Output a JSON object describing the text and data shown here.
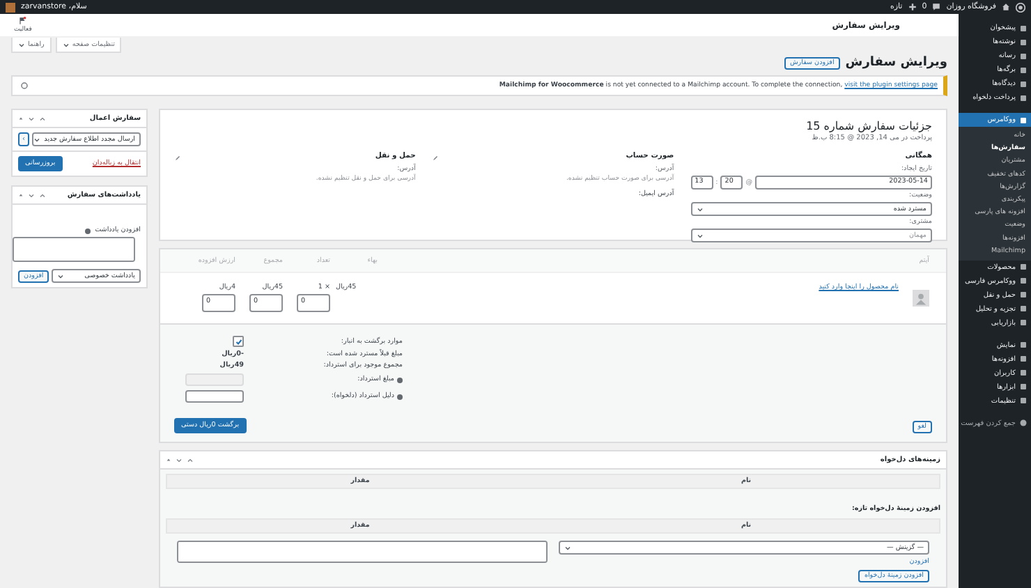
{
  "admin_bar": {
    "site_name": "فروشگاه روزان",
    "comments_count": "0",
    "new_label": "تازه",
    "greeting": "سلام، zarvanstore"
  },
  "admin_menu": {
    "groups": [
      [
        {
          "label": "پیشخوان",
          "selected": false
        },
        {
          "label": "نوشته‌ها",
          "selected": false
        },
        {
          "label": "رسانه",
          "selected": false
        },
        {
          "label": "برگه‌ها",
          "selected": false
        },
        {
          "label": "دیدگاه‌ها",
          "selected": false
        },
        {
          "label": "پرداخت دلخواه",
          "selected": false
        }
      ],
      [
        {
          "label": "ووکامرس",
          "selected": true,
          "children": [
            {
              "label": "خانه",
              "selected": false
            },
            {
              "label": "سفارش‌ها",
              "selected": true
            },
            {
              "label": "مشتریان",
              "selected": false
            },
            {
              "label": "کدهای تخفیف",
              "selected": false
            },
            {
              "label": "گزارش‌ها",
              "selected": false
            },
            {
              "label": "پیکربندی",
              "selected": false
            },
            {
              "label": "افزونه های پارسی",
              "selected": false
            },
            {
              "label": "وضعیت",
              "selected": false
            },
            {
              "label": "افزونه‌ها",
              "selected": false
            },
            {
              "label": "Mailchimp",
              "selected": false
            }
          ]
        },
        {
          "label": "محصولات",
          "selected": false
        },
        {
          "label": "ووکامرس فارسی",
          "selected": false
        },
        {
          "label": "حمل و نقل",
          "selected": false
        },
        {
          "label": "تجزیه و تحلیل",
          "selected": false
        },
        {
          "label": "بازاریابی",
          "selected": false
        }
      ],
      [
        {
          "label": "نمایش",
          "selected": false
        },
        {
          "label": "افزونه‌ها",
          "selected": false
        },
        {
          "label": "کاربران",
          "selected": false
        },
        {
          "label": "ابزارها",
          "selected": false
        },
        {
          "label": "تنظیمات",
          "selected": false
        }
      ]
    ],
    "collapse_label": "جمع کردن فهرست"
  },
  "header": {
    "title": "ویرایش سفارش",
    "activity_label": "فعالیت"
  },
  "screen_tabs": [
    "تنظیمات صفحه",
    "راهنما"
  ],
  "page_title": "ویرایش سفارش",
  "add_button": "افزودن سفارش",
  "notice": {
    "text": "**Mailchimp for Woocommerce** is not yet connected to a Mailchimp account. To complete the connection, ",
    "link": "visit the plugin settings page"
  },
  "order": {
    "title": "جزئیات سفارش شماره 15",
    "subtitle": "پرداخت در می 14, 2023 @ 8:15 ب.ظ",
    "general": {
      "heading": "همگانی",
      "date_label": "تاریخ ایجاد:",
      "date": "2023-05-14",
      "at": "@",
      "hour": "20",
      "colon": ":",
      "minute": "13",
      "status_label": "وضعیت:",
      "status": "مسترد شده",
      "customer_label": "مشتری:",
      "customer": "مهمان"
    },
    "billing": {
      "heading": "صورت حساب",
      "address_label": "آدرس:",
      "address_note": "آدرسی برای صورت حساب تنظیم نشده.",
      "email_label": "آدرس ایمیل:"
    },
    "shipping": {
      "heading": "حمل و نقل",
      "address_label": "آدرس:",
      "address_note": "آدرسی برای حمل و نقل تنظیم نشده."
    }
  },
  "items": {
    "columns": [
      "آیتم",
      "بهاء",
      "تعداد",
      "مجموع",
      "ارزش افزوده"
    ],
    "rows": [
      {
        "name": "نام محصول را اینجا وارد کنید",
        "price": "45ریال",
        "qty": "× 1",
        "qty_value": "0",
        "total": "45ریال",
        "total_value": "0",
        "tax": "4ریال",
        "tax_value": "0"
      }
    ],
    "refund": {
      "restock_label": "موارد برگشت به انبار:",
      "restock": true,
      "refunded_label": "مبلغ قبلاً مسترد شده است:",
      "refunded": "-0ریال",
      "available_label": "مجموع موجود برای استرداد:",
      "available": "49ریال",
      "amount_label": "مبلغ استرداد:",
      "reason_label": "دلیل استرداد (دلخواه):",
      "refund_button": "برگشت 0ریال دستی",
      "cancel_button": "لغو"
    }
  },
  "custom_fields": {
    "title": "زمینه‌های دل‌خواه",
    "columns": [
      "نام",
      "مقدار"
    ],
    "add_label": "افزودن زمینهٔ دل‌خواه تازه:",
    "add_columns": [
      "نام",
      "مقدار"
    ],
    "select": "— گزینش —",
    "enter_new": "افزودن",
    "add_button": "افزودن زمینهٔ دل‌خواه"
  },
  "order_actions": {
    "title": "سفارش اعمال",
    "action": "ارسال مجدد اطلاع سفارش جدید",
    "go_button": "›",
    "trash_link": "انتقال به زباله‌دان",
    "update_button": "بروزرسانی"
  },
  "order_notes": {
    "title": "یادداشت‌های سفارش",
    "add_label": "افزودن یادداشت",
    "note_type": "یادداشت خصوصی",
    "add_button": "افزودن"
  }
}
